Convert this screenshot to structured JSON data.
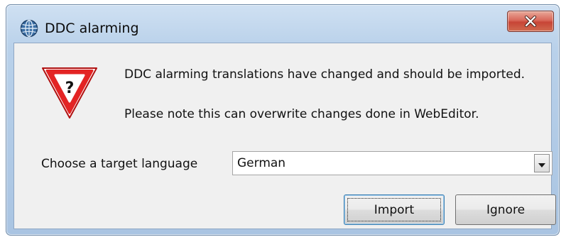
{
  "window": {
    "title": "DDC alarming",
    "icon": "globe-icon",
    "close_icon": "close-icon"
  },
  "message": {
    "icon": "warning-question-icon",
    "line1": "DDC alarming translations have changed and should be imported.",
    "line2": "Please note this can overwrite changes done in WebEditor."
  },
  "language": {
    "label": "Choose a target language",
    "selected": "German"
  },
  "buttons": {
    "import_label": "Import",
    "ignore_label": "Ignore"
  },
  "colors": {
    "close_button": "#c74536",
    "warning_red": "#e02020"
  }
}
